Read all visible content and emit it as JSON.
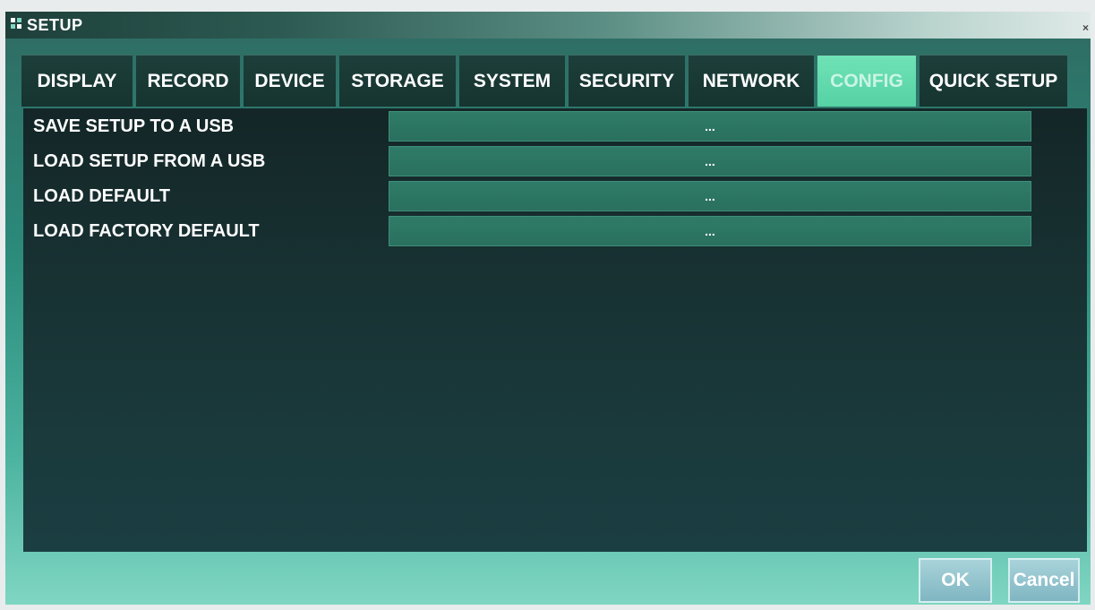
{
  "window": {
    "title": "SETUP",
    "close_glyph": "×",
    "title_icon": "grid-icon"
  },
  "tabs": [
    {
      "label": "DISPLAY",
      "active": false
    },
    {
      "label": "RECORD",
      "active": false
    },
    {
      "label": "DEVICE",
      "active": false
    },
    {
      "label": "STORAGE",
      "active": false
    },
    {
      "label": "SYSTEM",
      "active": false
    },
    {
      "label": "SECURITY",
      "active": false
    },
    {
      "label": "NETWORK",
      "active": false
    },
    {
      "label": "CONFIG",
      "active": true
    },
    {
      "label": "QUICK SETUP",
      "active": false
    }
  ],
  "config": {
    "rows": [
      {
        "label": "SAVE SETUP TO A USB",
        "button": "..."
      },
      {
        "label": "LOAD SETUP FROM A USB",
        "button": "..."
      },
      {
        "label": "LOAD DEFAULT",
        "button": "..."
      },
      {
        "label": "LOAD FACTORY DEFAULT",
        "button": "..."
      }
    ]
  },
  "footer": {
    "ok_label": "OK",
    "cancel_label": "Cancel"
  },
  "colors": {
    "active_tab": "#56d2a4",
    "inactive_tab": "#1d3e3a",
    "panel_bg": "#183233",
    "row_button": "#2f7b68"
  }
}
